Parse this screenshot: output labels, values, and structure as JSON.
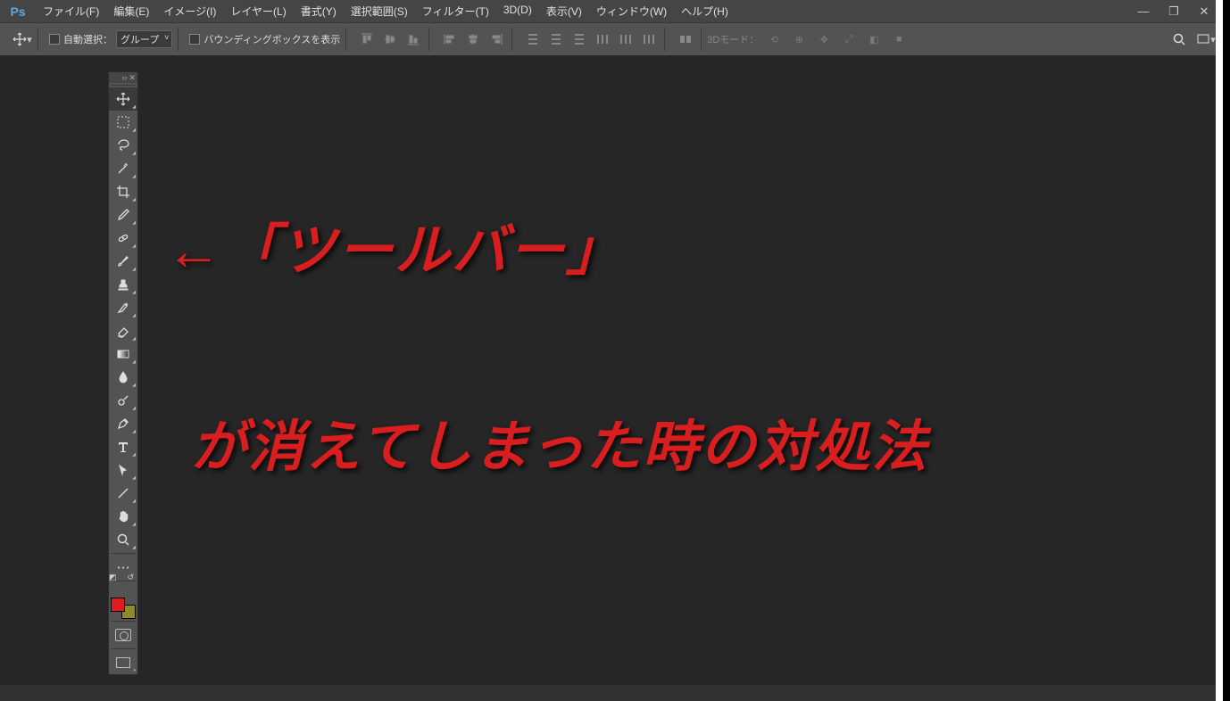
{
  "logo": "Ps",
  "menu": [
    "ファイル(F)",
    "編集(E)",
    "イメージ(I)",
    "レイヤー(L)",
    "書式(Y)",
    "選択範囲(S)",
    "フィルター(T)",
    "3D(D)",
    "表示(V)",
    "ウィンドウ(W)",
    "ヘルプ(H)"
  ],
  "window_controls": {
    "min": "—",
    "max": "❐",
    "close": "✕"
  },
  "options": {
    "auto_select_label": "自動選択：",
    "group_select": "グループ",
    "bounding_box_label": "バウンディングボックスを表示",
    "mode3d_label": "3Dモード："
  },
  "toolbar": {
    "tools": [
      {
        "id": "move",
        "icon": "move",
        "active": true
      },
      {
        "id": "marquee",
        "icon": "marquee"
      },
      {
        "id": "lasso",
        "icon": "lasso"
      },
      {
        "id": "wand",
        "icon": "wand"
      },
      {
        "id": "crop",
        "icon": "crop"
      },
      {
        "id": "eyedropper",
        "icon": "eyedropper"
      },
      {
        "id": "heal",
        "icon": "heal"
      },
      {
        "id": "brush",
        "icon": "brush"
      },
      {
        "id": "stamp",
        "icon": "stamp"
      },
      {
        "id": "history",
        "icon": "history"
      },
      {
        "id": "eraser",
        "icon": "eraser"
      },
      {
        "id": "gradient",
        "icon": "gradient"
      },
      {
        "id": "blur",
        "icon": "blur"
      },
      {
        "id": "dodge",
        "icon": "dodge"
      },
      {
        "id": "pen",
        "icon": "pen"
      },
      {
        "id": "type",
        "icon": "type"
      },
      {
        "id": "path",
        "icon": "path"
      },
      {
        "id": "line",
        "icon": "line"
      },
      {
        "id": "hand",
        "icon": "hand"
      },
      {
        "id": "zoom",
        "icon": "zoom"
      }
    ],
    "fg_color": "#e01b1b",
    "bg_color": "#8c8c2a"
  },
  "annotations": {
    "line1": "←「ツールバー」",
    "line2": "が消えてしまった時の対処法"
  }
}
